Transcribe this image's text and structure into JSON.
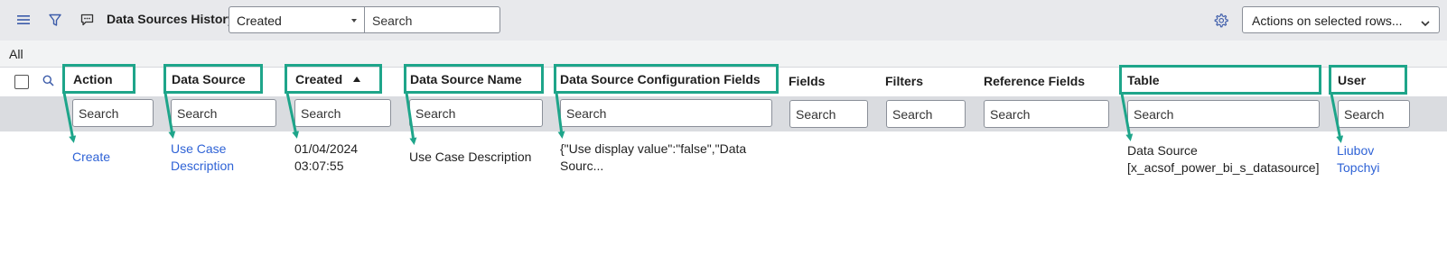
{
  "header": {
    "title": "Data Sources History",
    "sort_field": "Created",
    "search_placeholder": "Search",
    "actions_label": "Actions on selected rows..."
  },
  "list_tab": "All",
  "columns": [
    {
      "key": "action",
      "label": "Action",
      "highlighted": true,
      "sorted": ""
    },
    {
      "key": "data_source",
      "label": "Data Source",
      "highlighted": true,
      "sorted": ""
    },
    {
      "key": "created",
      "label": "Created",
      "highlighted": true,
      "sorted": "asc"
    },
    {
      "key": "data_source_name",
      "label": "Data Source Name",
      "highlighted": true,
      "sorted": ""
    },
    {
      "key": "config_fields",
      "label": "Data Source Configuration Fields",
      "highlighted": true,
      "sorted": ""
    },
    {
      "key": "fields",
      "label": "Fields",
      "highlighted": false,
      "sorted": ""
    },
    {
      "key": "filters",
      "label": "Filters",
      "highlighted": false,
      "sorted": ""
    },
    {
      "key": "reference_fields",
      "label": "Reference Fields",
      "highlighted": false,
      "sorted": ""
    },
    {
      "key": "table",
      "label": "Table",
      "highlighted": true,
      "sorted": ""
    },
    {
      "key": "user",
      "label": "User",
      "highlighted": true,
      "sorted": ""
    }
  ],
  "filter_placeholder": "Search",
  "rows": [
    {
      "action": "Create",
      "data_source": "Use Case Description",
      "created": "01/04/2024 03:07:55",
      "data_source_name": "Use Case Description",
      "config_fields": "{\"Use display value\":\"false\",\"Data Sourc...",
      "fields": "",
      "filters": "",
      "reference_fields": "",
      "table": "Data Source [x_acsof_power_bi_s_datasource]",
      "user": "Liubov Topchyi"
    }
  ],
  "icons": {
    "menu": "menu-icon",
    "filter": "filter-icon",
    "comment": "comment-icon",
    "gear": "gear-icon",
    "search": "search-icon",
    "sort": "sort-asc-icon"
  },
  "colors": {
    "highlight": "#1ea58a",
    "link": "#2f63d6",
    "topbar": "#e8e9ec"
  }
}
